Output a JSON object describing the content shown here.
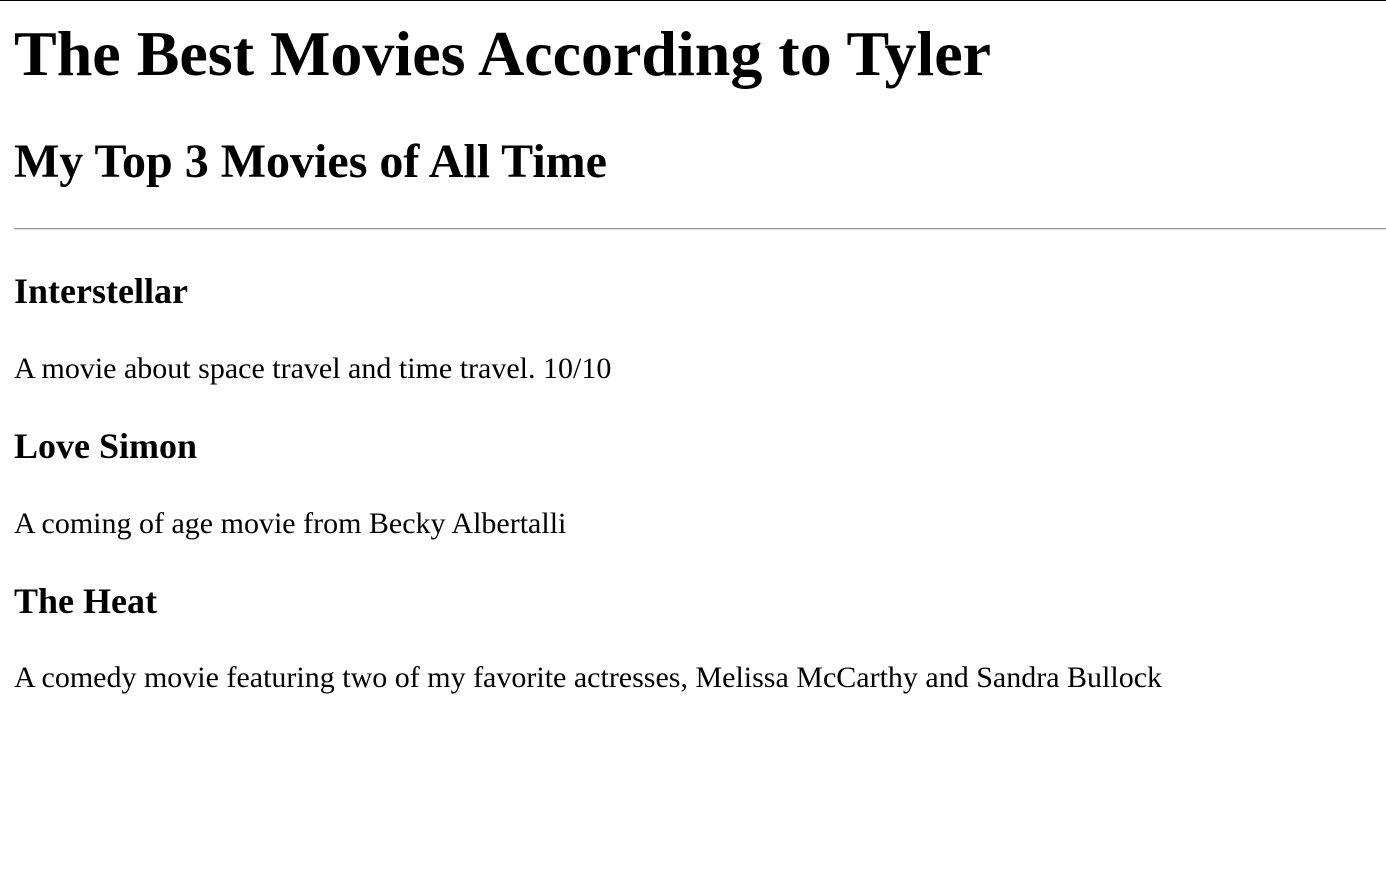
{
  "header": {
    "title": "The Best Movies According to Tyler",
    "subtitle": "My Top 3 Movies of All Time"
  },
  "movies": [
    {
      "title": "Interstellar",
      "description": "A movie about space travel and time travel. 10/10"
    },
    {
      "title": "Love Simon",
      "description": "A coming of age movie from Becky Albertalli"
    },
    {
      "title": "The Heat",
      "description": "A comedy movie featuring two of my favorite actresses, Melissa McCarthy and Sandra Bullock"
    }
  ]
}
